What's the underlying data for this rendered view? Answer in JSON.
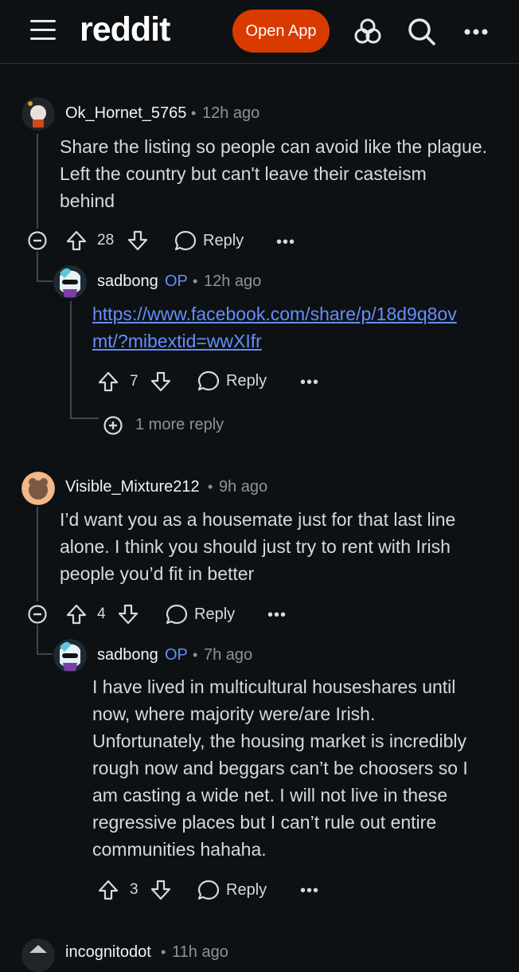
{
  "app": {
    "logo": "reddit",
    "open_app_label": "Open App"
  },
  "comments": [
    {
      "username": "Ok_Hornet_5765",
      "time": "12h ago",
      "body": [
        "Share the listing so people can avoid like the plague.",
        "Left the country but can't leave their casteism",
        "behind"
      ],
      "votes": "28",
      "reply_label": "Reply"
    },
    {
      "username": "sadbong",
      "op": "OP",
      "time": "12h ago",
      "link": [
        "https://www.facebook.com/share/p/18d9q8ov",
        "mt/?mibextid=wwXIfr"
      ],
      "votes": "7",
      "reply_label": "Reply",
      "more_replies": "1 more reply"
    },
    {
      "username": "Visible_Mixture212",
      "time": "9h ago",
      "body": [
        "I’d want you as a housemate just for that last line",
        "alone. I think you should just try to rent with Irish",
        "people you’d fit in better"
      ],
      "votes": "4",
      "reply_label": "Reply"
    },
    {
      "username": "sadbong",
      "op": "OP",
      "time": "7h ago",
      "body": [
        "I have lived in multicultural houseshares until",
        "now, where majority were/are Irish.",
        "Unfortunately, the housing market is incredibly",
        "rough now and beggars can’t be choosers so I",
        "am casting a wide net. I will not live in these",
        "regressive places but I can’t rule out entire",
        "communities hahaha."
      ],
      "votes": "3",
      "reply_label": "Reply"
    },
    {
      "username": "incognitodot",
      "time": "11h ago"
    }
  ],
  "separator": "•",
  "overflow_glyph": "•••",
  "colors": {
    "background": "#0e1113",
    "accent": "#d93a00",
    "link": "#648efc",
    "op": "#648efc",
    "meta": "#8a9399"
  }
}
